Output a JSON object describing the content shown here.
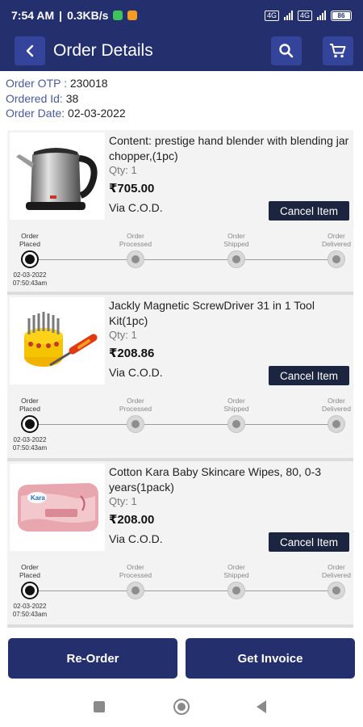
{
  "status_bar": {
    "time": "7:54 AM",
    "speed": "0.3KB/s",
    "battery": "86"
  },
  "header": {
    "title": "Order Details"
  },
  "order": {
    "otp_label": "Order OTP :",
    "otp": "230018",
    "id_label": "Ordered Id:",
    "id": "38",
    "date_label": "Order Date:",
    "date": "02-03-2022"
  },
  "items": [
    {
      "name": "Content: prestige hand blender with blending jar chopper,(1pc)",
      "qty": "Qty:  1",
      "price": "₹705.00",
      "payment": "Via C.O.D.",
      "cancel_label": "Cancel Item",
      "placed_date": "02-03-2022",
      "placed_time": "07:50:43am"
    },
    {
      "name": "Jackly Magnetic ScrewDriver 31 in 1 Tool Kit(1pc)",
      "qty": "Qty:  1",
      "price": "₹208.86",
      "payment": "Via C.O.D.",
      "cancel_label": "Cancel Item",
      "placed_date": "02-03-2022",
      "placed_time": "07:50:43am"
    },
    {
      "name": "Cotton Kara Baby Skincare Wipes, 80, 0-3 years(1pack)",
      "qty": "Qty:  1",
      "price": "₹208.00",
      "payment": "Via C.O.D.",
      "cancel_label": "Cancel Item",
      "placed_date": "02-03-2022",
      "placed_time": "07:50:43am"
    }
  ],
  "stages": {
    "placed_1": "Order",
    "placed_2": "Placed",
    "processed_1": "Order",
    "processed_2": "Processed",
    "shipped_1": "Order",
    "shipped_2": "Shipped",
    "delivered_1": "Order",
    "delivered_2": "Delivered"
  },
  "product_art": {
    "wipes_brand": "Kara"
  },
  "actions": {
    "reorder": "Re-Order",
    "invoice": "Get Invoice"
  },
  "colors": {
    "primary": "#24306e",
    "button_dark": "#1c2540"
  }
}
